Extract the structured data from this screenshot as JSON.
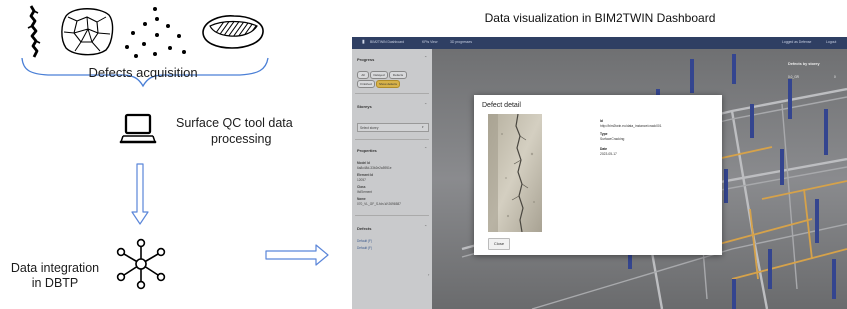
{
  "flow": {
    "acquisition_label": "Defects acquisition",
    "processing_label_1": "Surface QC tool data",
    "processing_label_2": "processing",
    "integration_label_1": "Data integration",
    "integration_label_2": "in DBTP"
  },
  "dashboard_title": "Data visualization in BIM2TWIN Dashboard",
  "dashboard": {
    "topbar": {
      "app_name": "BIM2TWIN Dashboard",
      "nav": [
        "KPIs View",
        "3D progresses"
      ],
      "user": "Logged as Defense",
      "logout": "Logout"
    },
    "sidebar": {
      "progress_title": "Progress",
      "chips": [
        "All",
        "Delayed",
        "Defects",
        "Finished",
        "Show defects"
      ],
      "storeys_title": "Storeys",
      "select_placeholder": "Select storey",
      "properties_title": "Properties",
      "properties": [
        {
          "key": "Model Id",
          "value": "6a8c48d-33b2e2a5951e"
        },
        {
          "key": "Element Id",
          "value": "12057"
        },
        {
          "key": "Class",
          "value": "IfcElement"
        },
        {
          "key": "Name",
          "value": "070_VL_GF_S-fdn-W:2696587"
        }
      ],
      "defects_title": "Defects",
      "defects": [
        "Default (F)",
        "Default (F)"
      ]
    },
    "right_panel": {
      "title": "Defects by storey",
      "rows": [
        {
          "label": "0.0_GR",
          "value": "0"
        },
        {
          "label": "",
          "value": ""
        }
      ]
    },
    "modal": {
      "title": "Defect detail",
      "fields": [
        {
          "key": "Id",
          "value": "http://bim2twin.eu/data_instance/crack001"
        },
        {
          "key": "Type",
          "value": "SurfaceCracking"
        },
        {
          "key": "Date",
          "value": "2023-05-17"
        }
      ],
      "close_label": "Close"
    }
  },
  "colors": {
    "connector": "#5b86d9",
    "brace": "#4a7fd6",
    "topbar": "#2f3f63",
    "active_chip": "#d7b24a",
    "column": "#34458f"
  },
  "icons": [
    "crack-icon",
    "cracked-surface-icon",
    "dots-icon",
    "hatched-patch-icon",
    "laptop-icon",
    "network-icon",
    "arrow-down-icon",
    "arrow-right-icon"
  ]
}
